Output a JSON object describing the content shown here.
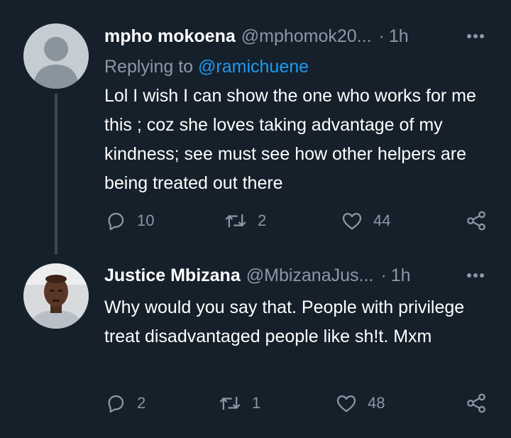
{
  "tweets": [
    {
      "name": "mpho mokoena",
      "handle": "@mphomok20...",
      "dot": "·",
      "time": "1h",
      "replying_prefix": "Replying to",
      "replying_to": "@ramichuene",
      "text": "Lol I wish I can show the one who works for me this ; coz she loves taking advantage of my kindness; see must see how other helpers are being treated out there",
      "replies": "10",
      "retweets": "2",
      "likes": "44",
      "avatar": "default-avatar-icon"
    },
    {
      "name": "Justice Mbizana",
      "handle": "@MbizanaJus...",
      "dot": "·",
      "time": "1h",
      "text": "Why would you say that. People with privilege treat disadvantaged people like sh!t. Mxm",
      "replies": "2",
      "retweets": "1",
      "likes": "48",
      "avatar": "profile-photo"
    }
  ],
  "colors": {
    "background": "#15202b",
    "text": "#ffffff",
    "secondary": "#8b98a5",
    "link": "#1d9bf0",
    "thread_line": "#3d4954"
  }
}
